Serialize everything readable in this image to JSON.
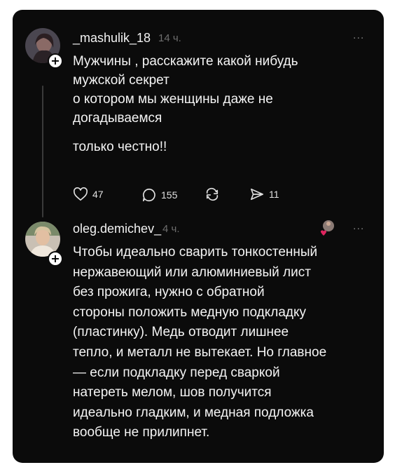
{
  "post": {
    "username": "_mashulik_18",
    "time": "14 ч.",
    "more": "...",
    "lines": [
      "Мужчины , расскажите какой нибудь",
      "мужской секрет",
      "о котором мы женщины  даже не",
      "догадываемся"
    ],
    "line_extra": "только честно!!",
    "likes": "47",
    "comments": "155",
    "shares": "11"
  },
  "reply": {
    "username": "oleg.demichev_",
    "time": "4 ч.",
    "more": "...",
    "lines": [
      "Чтобы идеально сварить тонкостенный",
      "нержавеющий или алюминиевый лист",
      "без прожига, нужно с обратной",
      "стороны положить медную подкладку",
      "(пластинку). Медь отводит лишнее",
      "тепло, и металл не вытекает. Но главное",
      "— если подкладку перед сваркой",
      "натереть мелом, шов получится",
      "идеально гладким, и медная подложка",
      "вообще не прилипнет."
    ]
  },
  "colors": {
    "background": "#0b0b0b",
    "text": "#f4f4f4",
    "muted": "#6e6e6e",
    "like_red": "#e0245e"
  }
}
